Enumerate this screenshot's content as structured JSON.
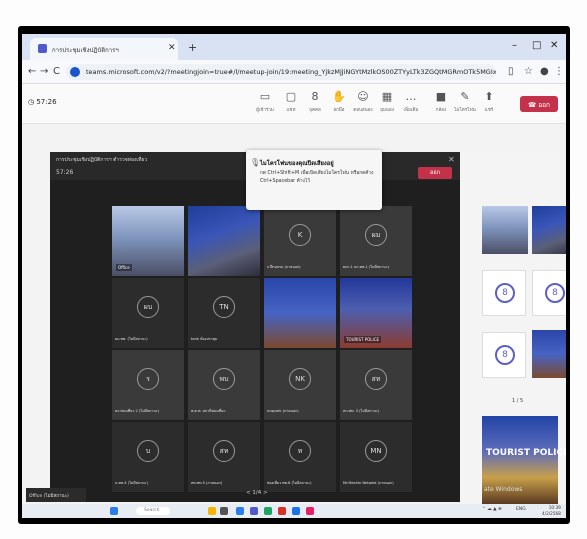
{
  "browser": {
    "tab_title": "การประชุมเชิงปฏิบัติการฯ",
    "tab_close": "✕",
    "new_tab": "+",
    "url": "teams.microsoft.com/v2/?meetingjoin=true#/l/meetup-join/19:meeting_YjkzMjJiNGYtMzlkOS00ZTYyLTk3ZGQtMGRmOTk5MGIxYGMx@thread.v2/0?co...",
    "back": "←",
    "forward": "→",
    "reload": "C",
    "minimize": "–",
    "maximize": "□",
    "close": "✕"
  },
  "teams": {
    "timer": "57:26",
    "toolbar": [
      {
        "icon": "camera-icon",
        "glyph": "▭",
        "label": "ผู้เข้าร่วม"
      },
      {
        "icon": "chat-icon",
        "glyph": "▢",
        "label": "แชท"
      },
      {
        "icon": "people-icon",
        "glyph": "8",
        "label": "บุคคล"
      },
      {
        "icon": "raise-hand-icon",
        "glyph": "✋",
        "label": "ยกมือ"
      },
      {
        "icon": "react-icon",
        "glyph": "☺",
        "label": "ตอบสนอง"
      },
      {
        "icon": "view-icon",
        "glyph": "▦",
        "label": "มุมมอง"
      },
      {
        "icon": "more-icon",
        "glyph": "…",
        "label": "เพิ่มเติม"
      },
      {
        "icon": "camera-off-icon",
        "glyph": "■",
        "label": "กล้อง"
      },
      {
        "icon": "mic-icon",
        "glyph": "✎",
        "label": "ไมโครโฟน"
      },
      {
        "icon": "share-icon",
        "glyph": "⬆",
        "label": "แชร์"
      }
    ],
    "leave_label": "ออก"
  },
  "inner_meeting": {
    "title": "การประชุมเชิงปฏิบัติการฯ ตำรวจท่องเที่ยว",
    "timer": "57:26",
    "leave_label": "ออก",
    "close": "✕",
    "tiles": [
      {
        "kind": "video",
        "label": "Office"
      },
      {
        "kind": "video",
        "label": ""
      },
      {
        "kind": "avatar",
        "initials": "K",
        "name": "ก.ฝึกอบรม (ภายนอก)"
      },
      {
        "kind": "avatar",
        "initials": "ผม",
        "name": "ผกก.1 บก.ทท.1 (ไม่มีสถานะ)"
      },
      {
        "kind": "avatar",
        "initials": "ผบ",
        "name": "ผบ.ทท. (ไม่มีสถานะ)"
      },
      {
        "kind": "avatar",
        "initials": "TN",
        "name": "tank ห้องประชุม"
      },
      {
        "kind": "video",
        "label": ""
      },
      {
        "kind": "video",
        "label": "TOURIST POLICE"
      },
      {
        "kind": "avatar",
        "initials": "ร",
        "name": "ตร.ท่องเที่ยว 2 (ไม่มีสถานะ)"
      },
      {
        "kind": "avatar",
        "initials": "พบ",
        "name": "พ.ต.ท. สถานีท่องเที่ยว"
      },
      {
        "kind": "avatar",
        "initials": "NK",
        "name": "nuspark (ภายนอก)"
      },
      {
        "kind": "avatar",
        "initials": "สท",
        "name": "สภ.ทท. 3 (ไม่มีสถานะ)"
      },
      {
        "kind": "avatar",
        "initials": "บ",
        "name": "บ.ทท.4 (ไม่มีสถานะ)"
      },
      {
        "kind": "avatar",
        "initials": "สท",
        "name": "สท.ทท.5 (ภายนอก)"
      },
      {
        "kind": "avatar",
        "initials": "ท",
        "name": "ท่องเที่ยว ทท.6 (ไม่มีสถานะ)"
      },
      {
        "kind": "avatar",
        "initials": "MN",
        "name": "Mr.Machin Netpeid (ภายนอก)"
      }
    ],
    "pager": "< 1/4 >",
    "office_label": "Office (ไม่มีสถานะ)"
  },
  "notice": {
    "title": "ไมโครโฟนของคุณปิดเสียงอยู่",
    "body": "กด Ctrl+Shift+M เพื่อเปิดเสียงไมโครโฟน หรือกดค้าง Ctrl+Spacebar ค้างไว้"
  },
  "right_panel": {
    "pager": "1 / 5",
    "big_text": "TOURIST POLICE",
    "watermark": "ate Windows"
  },
  "taskbar": {
    "search_placeholder": "Search",
    "lang": "ENG",
    "time": "10:39",
    "date": "4/2/2568"
  }
}
